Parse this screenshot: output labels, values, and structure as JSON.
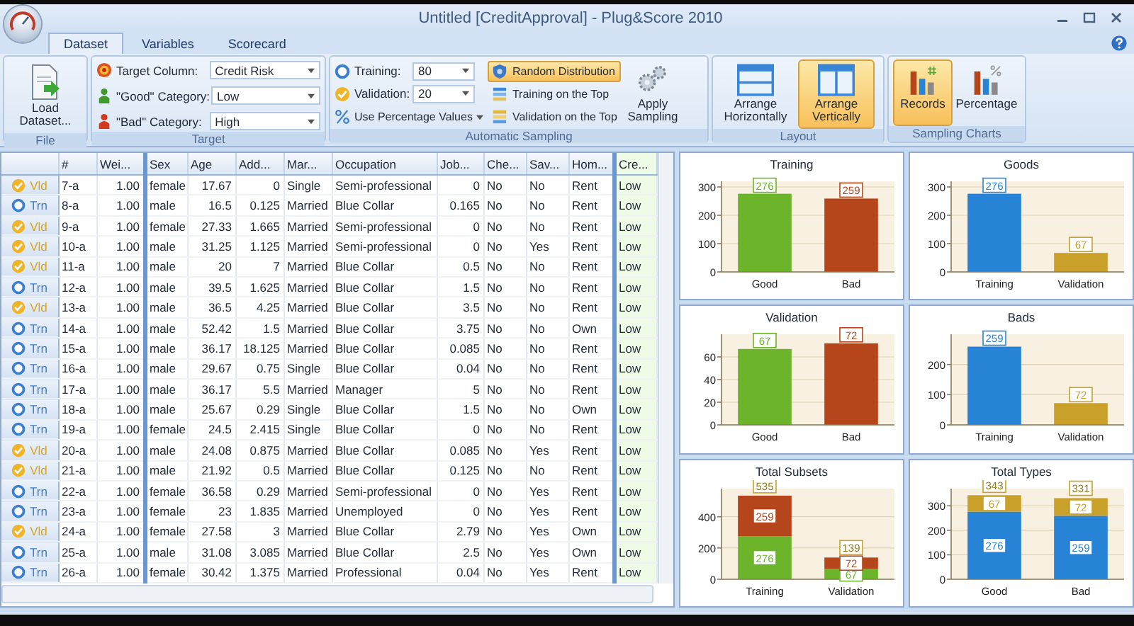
{
  "window": {
    "title": "Untitled [CreditApproval] - Plug&Score 2010"
  },
  "tabs": [
    {
      "label": "Dataset",
      "selected": true
    },
    {
      "label": "Variables",
      "selected": false
    },
    {
      "label": "Scorecard",
      "selected": false
    }
  ],
  "file_group": {
    "caption": "File",
    "load_button": "Load Dataset..."
  },
  "target_group": {
    "caption": "Target",
    "fields": [
      {
        "label": "Target Column:",
        "value": "Credit Risk",
        "kind": "target"
      },
      {
        "label": "\"Good\" Category:",
        "value": "Low",
        "kind": "good"
      },
      {
        "label": "\"Bad\" Category:",
        "value": "High",
        "kind": "bad"
      }
    ]
  },
  "sampling_group": {
    "caption": "Automatic Sampling",
    "fields": [
      {
        "label": "Training:",
        "value": "80",
        "kind": "training"
      },
      {
        "label": "Validation:",
        "value": "20",
        "kind": "validation"
      }
    ],
    "percentage_menu": "Use Percentage Values",
    "options": [
      {
        "label": "Random Distribution",
        "selected": true,
        "kind": "random"
      },
      {
        "label": "Training on the Top",
        "selected": false,
        "kind": "training-top"
      },
      {
        "label": "Validation on the Top",
        "selected": false,
        "kind": "validation-top"
      }
    ],
    "apply_button": "Apply Sampling"
  },
  "layout_group": {
    "caption": "Layout",
    "buttons": [
      {
        "label": "Arrange Horizontally",
        "selected": false,
        "kind": "horizontal"
      },
      {
        "label": "Arrange Vertically",
        "selected": true,
        "kind": "vertical"
      }
    ]
  },
  "charts_group": {
    "caption": "Sampling Charts",
    "buttons": [
      {
        "label": "Records",
        "selected": true,
        "kind": "records"
      },
      {
        "label": "Percentage",
        "selected": false,
        "kind": "percentage"
      }
    ]
  },
  "table": {
    "columns": [
      {
        "label": "#",
        "kind": "text"
      },
      {
        "label": "Wei...",
        "kind": "number"
      },
      {
        "label": "Sex",
        "kind": "text"
      },
      {
        "label": "Age",
        "kind": "number"
      },
      {
        "label": "Add...",
        "kind": "number"
      },
      {
        "label": "Mar...",
        "kind": "text"
      },
      {
        "label": "Occupation",
        "kind": "text"
      },
      {
        "label": "Job...",
        "kind": "number"
      },
      {
        "label": "Che...",
        "kind": "text"
      },
      {
        "label": "Sav...",
        "kind": "text"
      },
      {
        "label": "Hom...",
        "kind": "text"
      },
      {
        "label": "Cre...",
        "kind": "target"
      }
    ],
    "rows": [
      {
        "sample": "Vld",
        "kind": "validation",
        "cells": [
          "7-a",
          "1.00",
          "female",
          "17.67",
          "0",
          "Single",
          "Semi-professional",
          "0",
          "No",
          "No",
          "Rent",
          "Low"
        ]
      },
      {
        "sample": "Trn",
        "kind": "training",
        "cells": [
          "8-a",
          "1.00",
          "male",
          "16.5",
          "0.125",
          "Married",
          "Blue Collar",
          "0.165",
          "No",
          "No",
          "Rent",
          "Low"
        ]
      },
      {
        "sample": "Vld",
        "kind": "validation",
        "cells": [
          "9-a",
          "1.00",
          "female",
          "27.33",
          "1.665",
          "Married",
          "Semi-professional",
          "0",
          "No",
          "No",
          "Rent",
          "Low"
        ]
      },
      {
        "sample": "Vld",
        "kind": "validation",
        "cells": [
          "10-a",
          "1.00",
          "male",
          "31.25",
          "1.125",
          "Married",
          "Semi-professional",
          "0",
          "No",
          "Yes",
          "Rent",
          "Low"
        ]
      },
      {
        "sample": "Vld",
        "kind": "validation",
        "cells": [
          "11-a",
          "1.00",
          "male",
          "20",
          "7",
          "Married",
          "Blue Collar",
          "0.5",
          "No",
          "No",
          "Rent",
          "Low"
        ]
      },
      {
        "sample": "Trn",
        "kind": "training",
        "cells": [
          "12-a",
          "1.00",
          "male",
          "39.5",
          "1.625",
          "Married",
          "Blue Collar",
          "1.5",
          "No",
          "No",
          "Rent",
          "Low"
        ]
      },
      {
        "sample": "Vld",
        "kind": "validation",
        "cells": [
          "13-a",
          "1.00",
          "male",
          "36.5",
          "4.25",
          "Married",
          "Blue Collar",
          "3.5",
          "No",
          "No",
          "Rent",
          "Low"
        ]
      },
      {
        "sample": "Trn",
        "kind": "training",
        "cells": [
          "14-a",
          "1.00",
          "male",
          "52.42",
          "1.5",
          "Married",
          "Blue Collar",
          "3.75",
          "No",
          "No",
          "Own",
          "Low"
        ]
      },
      {
        "sample": "Trn",
        "kind": "training",
        "cells": [
          "15-a",
          "1.00",
          "male",
          "36.17",
          "18.125",
          "Married",
          "Blue Collar",
          "0.085",
          "No",
          "No",
          "Rent",
          "Low"
        ]
      },
      {
        "sample": "Trn",
        "kind": "training",
        "cells": [
          "16-a",
          "1.00",
          "male",
          "29.67",
          "0.75",
          "Single",
          "Blue Collar",
          "0.04",
          "No",
          "No",
          "Rent",
          "Low"
        ]
      },
      {
        "sample": "Trn",
        "kind": "training",
        "cells": [
          "17-a",
          "1.00",
          "male",
          "36.17",
          "5.5",
          "Married",
          "Manager",
          "5",
          "No",
          "No",
          "Rent",
          "Low"
        ]
      },
      {
        "sample": "Trn",
        "kind": "training",
        "cells": [
          "18-a",
          "1.00",
          "male",
          "25.67",
          "0.29",
          "Single",
          "Blue Collar",
          "1.5",
          "No",
          "No",
          "Own",
          "Low"
        ]
      },
      {
        "sample": "Trn",
        "kind": "training",
        "cells": [
          "19-a",
          "1.00",
          "female",
          "24.5",
          "2.415",
          "Single",
          "Blue Collar",
          "0",
          "No",
          "No",
          "Rent",
          "Low"
        ]
      },
      {
        "sample": "Vld",
        "kind": "validation",
        "cells": [
          "20-a",
          "1.00",
          "male",
          "24.08",
          "0.875",
          "Married",
          "Blue Collar",
          "0.085",
          "No",
          "Yes",
          "Rent",
          "Low"
        ]
      },
      {
        "sample": "Vld",
        "kind": "validation",
        "cells": [
          "21-a",
          "1.00",
          "male",
          "21.92",
          "0.5",
          "Married",
          "Blue Collar",
          "0.125",
          "No",
          "No",
          "Rent",
          "Low"
        ]
      },
      {
        "sample": "Trn",
        "kind": "training",
        "cells": [
          "22-a",
          "1.00",
          "female",
          "36.58",
          "0.29",
          "Married",
          "Semi-professional",
          "0",
          "No",
          "Yes",
          "Rent",
          "Low"
        ]
      },
      {
        "sample": "Trn",
        "kind": "training",
        "cells": [
          "23-a",
          "1.00",
          "female",
          "23",
          "1.835",
          "Married",
          "Unemployed",
          "0",
          "No",
          "Yes",
          "Rent",
          "Low"
        ]
      },
      {
        "sample": "Vld",
        "kind": "validation",
        "cells": [
          "24-a",
          "1.00",
          "female",
          "27.58",
          "3",
          "Married",
          "Blue Collar",
          "2.79",
          "No",
          "Yes",
          "Own",
          "Low"
        ]
      },
      {
        "sample": "Trn",
        "kind": "training",
        "cells": [
          "25-a",
          "1.00",
          "male",
          "31.08",
          "3.085",
          "Married",
          "Blue Collar",
          "2.5",
          "No",
          "Yes",
          "Own",
          "Low"
        ]
      },
      {
        "sample": "Trn",
        "kind": "training",
        "cells": [
          "26-a",
          "1.00",
          "female",
          "30.42",
          "1.375",
          "Married",
          "Professional",
          "0.04",
          "No",
          "Yes",
          "Rent",
          "Low"
        ]
      }
    ]
  },
  "charts": [
    {
      "chart_data": {
        "type": "bar",
        "title": "Training",
        "categories": [
          "Good",
          "Bad"
        ],
        "stacked": true,
        "grid": true,
        "data_labels": true,
        "ylim": [
          0,
          320
        ],
        "yticks": [
          0,
          100,
          200,
          300
        ],
        "series": [
          {
            "color": "#6cb52a",
            "values": [
              276,
              null
            ]
          },
          {
            "color": "#b5461c",
            "values": [
              null,
              259
            ]
          }
        ]
      }
    },
    {
      "chart_data": {
        "type": "bar",
        "title": "Goods",
        "categories": [
          "Training",
          "Validation"
        ],
        "stacked": true,
        "grid": true,
        "data_labels": true,
        "ylim": [
          0,
          320
        ],
        "yticks": [
          0,
          100,
          200,
          300
        ],
        "series": [
          {
            "color": "#2683d6",
            "values": [
              276,
              null
            ]
          },
          {
            "color": "#c9a02a",
            "values": [
              null,
              67
            ]
          }
        ]
      }
    },
    {
      "chart_data": {
        "type": "bar",
        "title": "Validation",
        "categories": [
          "Good",
          "Bad"
        ],
        "stacked": true,
        "grid": true,
        "data_labels": true,
        "ylim": [
          0,
          80
        ],
        "yticks": [
          0,
          20,
          40,
          60
        ],
        "series": [
          {
            "color": "#6cb52a",
            "values": [
              67,
              null
            ]
          },
          {
            "color": "#b5461c",
            "values": [
              null,
              72
            ]
          }
        ]
      }
    },
    {
      "chart_data": {
        "type": "bar",
        "title": "Bads",
        "categories": [
          "Training",
          "Validation"
        ],
        "stacked": true,
        "grid": true,
        "data_labels": true,
        "ylim": [
          0,
          300
        ],
        "yticks": [
          0,
          100,
          200
        ],
        "series": [
          {
            "color": "#2683d6",
            "values": [
              259,
              null
            ]
          },
          {
            "color": "#c9a02a",
            "values": [
              null,
              72
            ]
          }
        ]
      }
    },
    {
      "chart_data": {
        "type": "bar",
        "title": "Total Subsets",
        "categories": [
          "Training",
          "Validation"
        ],
        "stacked": true,
        "grid": true,
        "data_labels": true,
        "ylim": [
          0,
          580
        ],
        "yticks": [
          0,
          200,
          400
        ],
        "series": [
          {
            "color": "#6cb52a",
            "values": [
              276,
              67
            ]
          },
          {
            "color": "#b5461c",
            "values": [
              259,
              72
            ]
          }
        ],
        "annotations": [
          {
            "x": "Training",
            "y": 535,
            "text": "535"
          },
          {
            "x": "Validation",
            "y": 139,
            "text": "139"
          }
        ]
      }
    },
    {
      "chart_data": {
        "type": "bar",
        "title": "Total Types",
        "categories": [
          "Good",
          "Bad"
        ],
        "stacked": true,
        "grid": true,
        "data_labels": true,
        "ylim": [
          0,
          370
        ],
        "yticks": [
          0,
          100,
          200,
          300
        ],
        "series": [
          {
            "color": "#2683d6",
            "values": [
              276,
              259
            ]
          },
          {
            "color": "#c9a02a",
            "values": [
              67,
              72
            ]
          }
        ],
        "annotations": [
          {
            "x": "Good",
            "y": 343,
            "text": "343"
          },
          {
            "x": "Bad",
            "y": 331,
            "text": "331"
          }
        ]
      }
    }
  ]
}
